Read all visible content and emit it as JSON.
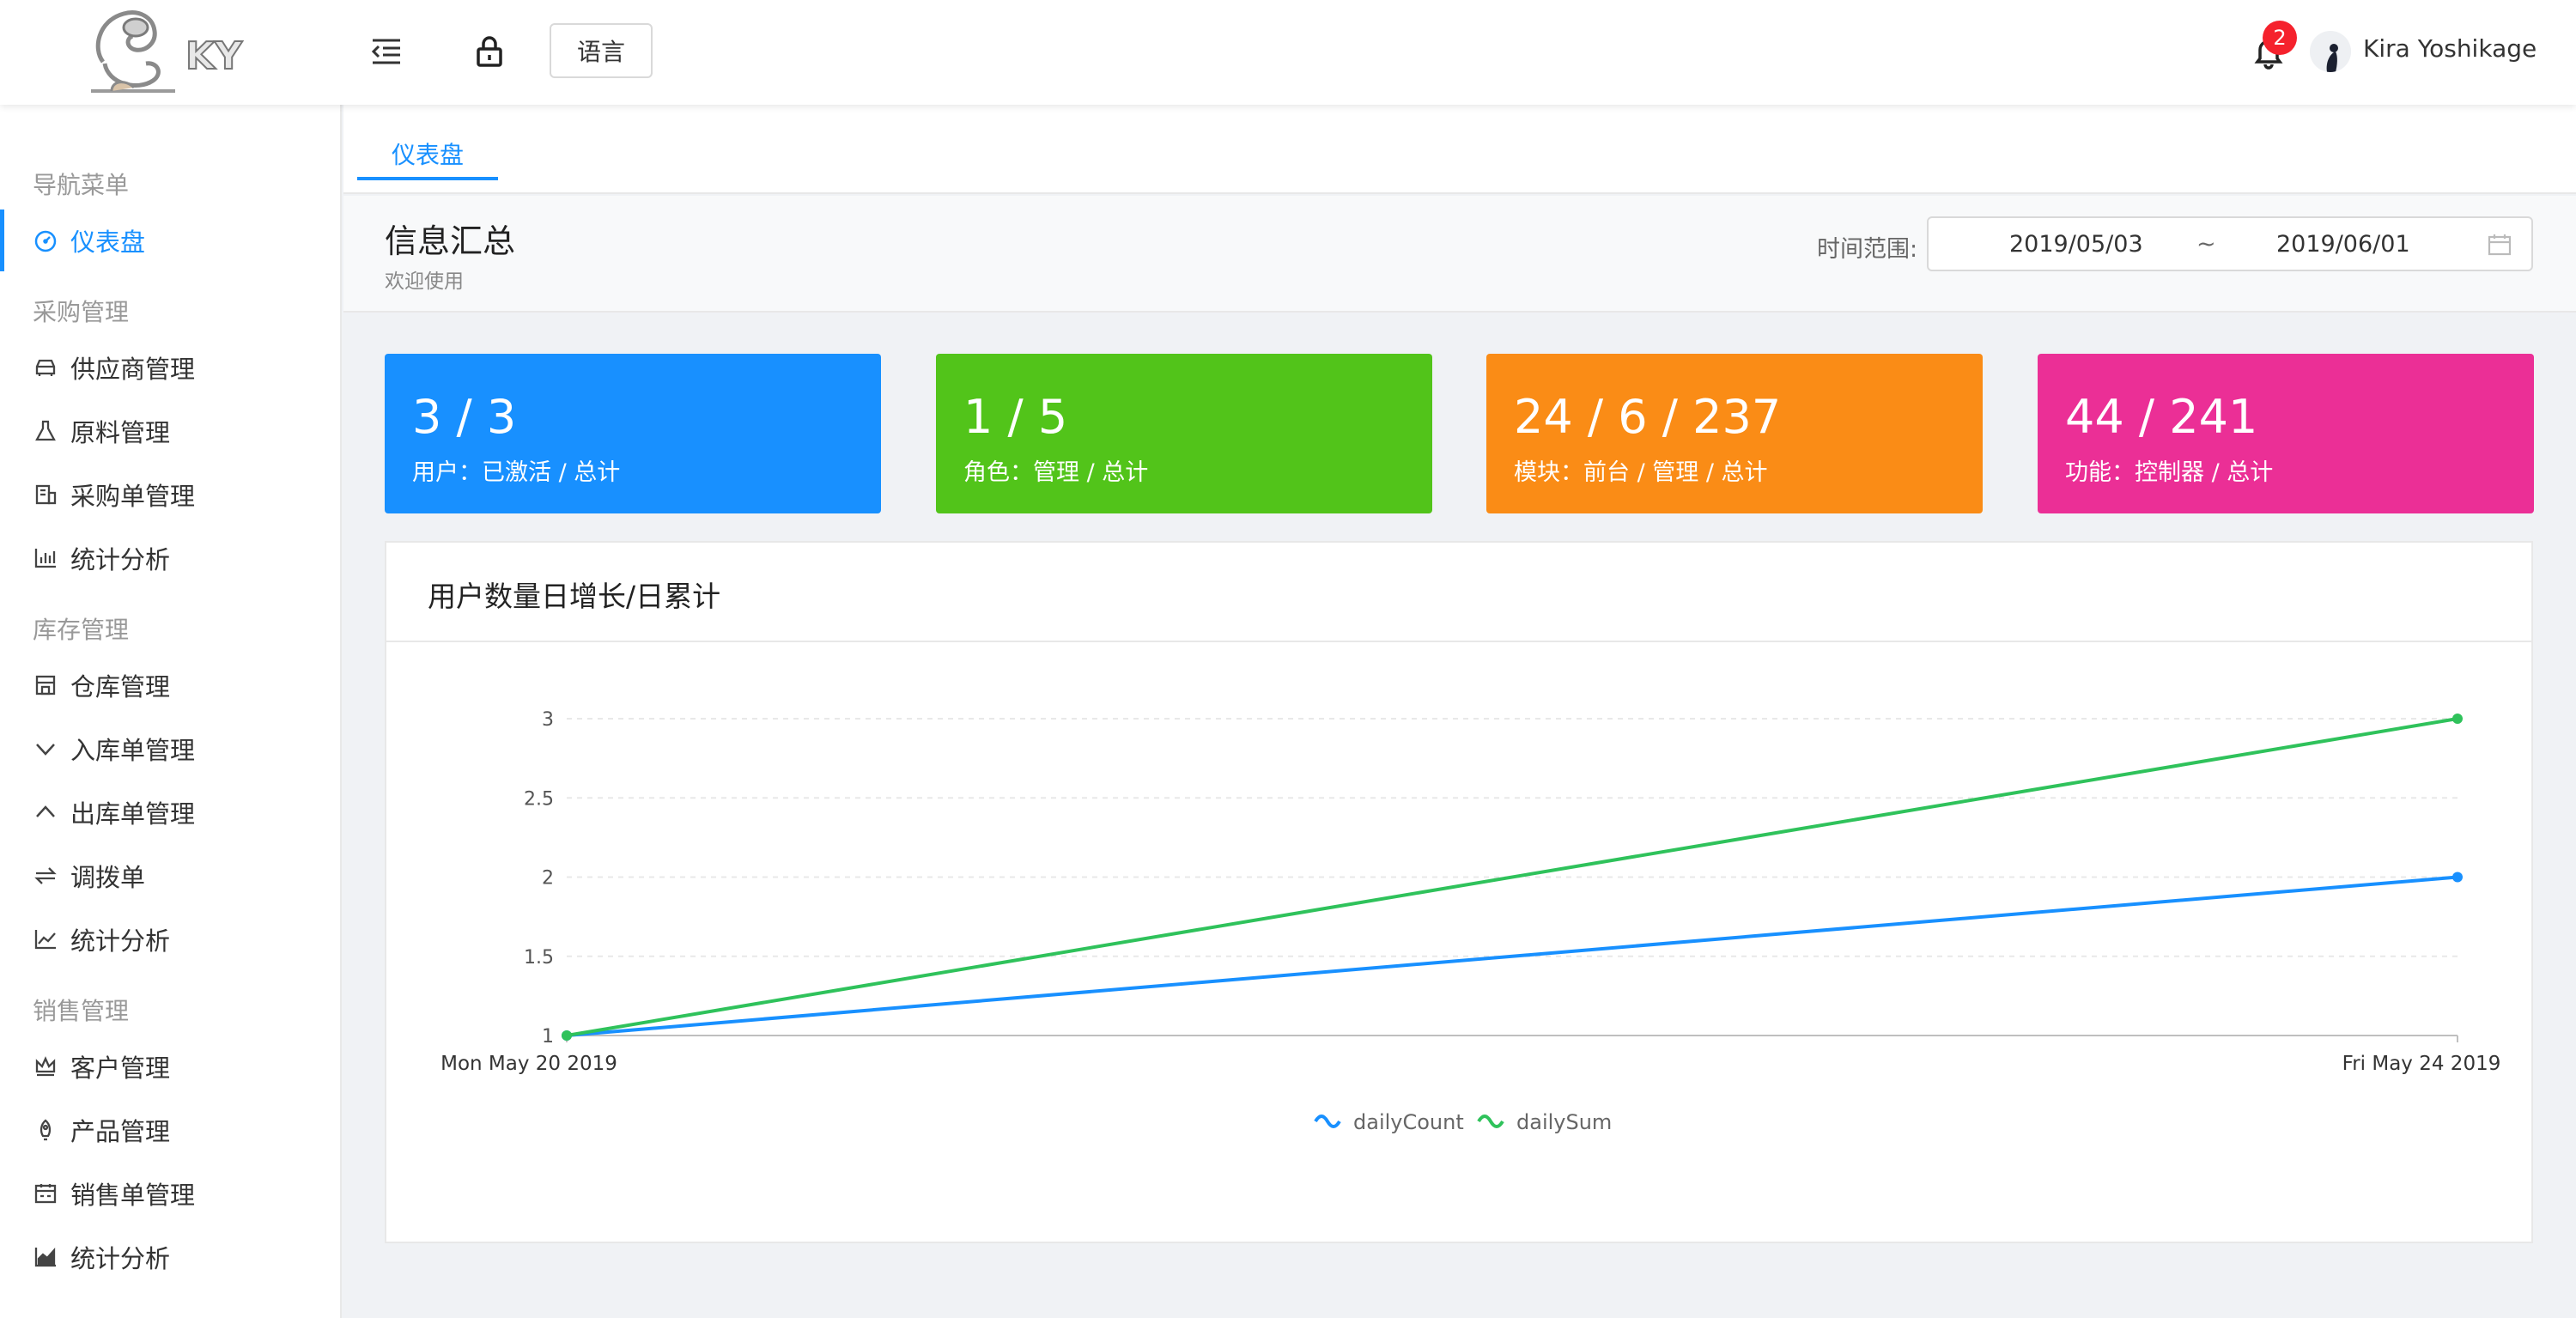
{
  "header": {
    "logo_text": "KY",
    "language_label": "语言",
    "notification_count": "2",
    "username": "Kira Yoshikage",
    "icons": [
      "menu-fold-icon",
      "lock-icon",
      "bell-icon"
    ]
  },
  "sidebar": {
    "groups": [
      {
        "label": "导航菜单",
        "items": [
          {
            "label": "仪表盘",
            "icon": "dashboard-icon",
            "active": true
          }
        ]
      },
      {
        "label": "采购管理",
        "items": [
          {
            "label": "供应商管理",
            "icon": "car-icon"
          },
          {
            "label": "原料管理",
            "icon": "experiment-icon"
          },
          {
            "label": "采购单管理",
            "icon": "bank-icon"
          },
          {
            "label": "统计分析",
            "icon": "bar-chart-icon"
          }
        ]
      },
      {
        "label": "库存管理",
        "items": [
          {
            "label": "仓库管理",
            "icon": "shop-icon"
          },
          {
            "label": "入库单管理",
            "icon": "down-icon"
          },
          {
            "label": "出库单管理",
            "icon": "up-icon"
          },
          {
            "label": "调拨单",
            "icon": "swap-icon"
          },
          {
            "label": "统计分析",
            "icon": "line-chart-icon"
          }
        ]
      },
      {
        "label": "销售管理",
        "items": [
          {
            "label": "客户管理",
            "icon": "crown-icon"
          },
          {
            "label": "产品管理",
            "icon": "rocket-icon"
          },
          {
            "label": "销售单管理",
            "icon": "calculator-icon"
          },
          {
            "label": "统计分析",
            "icon": "area-chart-icon"
          }
        ]
      }
    ]
  },
  "tabs": [
    {
      "label": "仪表盘",
      "active": true
    }
  ],
  "page": {
    "title": "信息汇总",
    "subtitle": "欢迎使用",
    "range_label": "时间范围:",
    "range_start": "2019/05/03",
    "range_separator": "~",
    "range_end": "2019/06/01"
  },
  "cards": [
    {
      "value": "3 / 3",
      "label": "用户：已激活 / 总计",
      "color": "#1890ff"
    },
    {
      "value": "1 / 5",
      "label": "角色：管理 / 总计",
      "color": "#52c41a"
    },
    {
      "value": "24 / 6 / 237",
      "label": "模块：前台 / 管理 / 总计",
      "color": "#fa8c16"
    },
    {
      "value": "44 / 241",
      "label": "功能：控制器 / 总计",
      "color": "#eb2f96"
    }
  ],
  "chart_title": "用户数量日增长/日累计",
  "chart_data": {
    "type": "line",
    "x": [
      "Mon May 20 2019",
      "Fri May 24 2019"
    ],
    "series": [
      {
        "name": "dailyCount",
        "values": [
          1,
          2
        ],
        "color": "#1890ff"
      },
      {
        "name": "dailySum",
        "values": [
          1,
          3
        ],
        "color": "#2fc25b"
      }
    ],
    "y_ticks": [
      "1",
      "1.5",
      "2",
      "2.5",
      "3"
    ],
    "ylim": [
      1,
      3
    ],
    "grid": true,
    "legend_position": "bottom-center"
  }
}
